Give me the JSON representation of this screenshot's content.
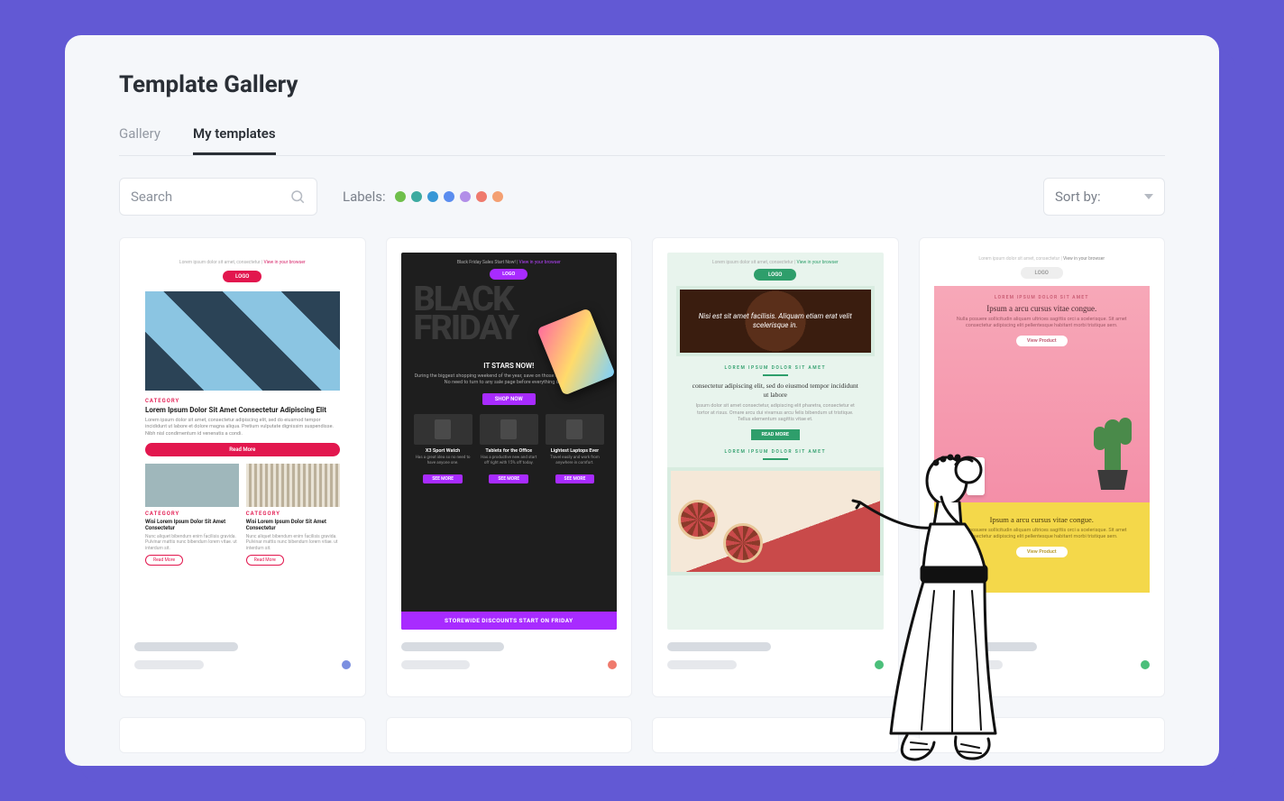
{
  "page_title": "Template Gallery",
  "tabs": [
    {
      "id": "gallery",
      "label": "Gallery",
      "active": false
    },
    {
      "id": "mytemplates",
      "label": "My templates",
      "active": true
    }
  ],
  "search": {
    "placeholder": "Search"
  },
  "labels": {
    "label": "Labels:",
    "colors": [
      "#6fbf4b",
      "#3daaa0",
      "#3897d6",
      "#5b8def",
      "#b28ee8",
      "#ef7a6d",
      "#f4a072"
    ]
  },
  "sort": {
    "label": "Sort by:"
  },
  "cards": [
    {
      "id": "t1",
      "dot_color": "#7b8fe0",
      "preheader": "Lorem ipsum dolor sit amet, consectetur |",
      "view_link": "View in your browser",
      "logo": "LOGO",
      "category": "CATEGORY",
      "headline": "Lorem Ipsum Dolor Sit Amet Consectetur Adipiscing Elit",
      "body": "Lorem ipsum dolor sit amet, consectetur adipiscing elit, sed do eiusmod tempor incididunt ut labore et dolore magna aliqua. Pretium vulputate dignissim suspendisse. Nibh nisl condimentum id venenatis a condi.",
      "read_more": "Read More",
      "cols": [
        {
          "category": "CATEGORY",
          "title": "Wisi Lorem Ipsum Dolor Sit Amet Consectetur",
          "body": "Nunc aliquet bibendum enim facilisis gravida. Pulvinar mattis nunc bibendum lorem vitae. ut interdum sit.",
          "cta": "Read More"
        },
        {
          "category": "CATEGORY",
          "title": "Wisi Lorem Ipsum Dolor Sit Amet Consectetur",
          "body": "Nunc aliquet bibendum enim facilisis gravida. Pulvinar mattis nunc bibendum lorem vitae. ut interdum sit.",
          "cta": "Read More"
        }
      ]
    },
    {
      "id": "t2",
      "dot_color": "#ef7a6d",
      "preheader": "Black Friday Sales Start Now! |",
      "view_link": "View in your browser",
      "logo": "LOGO",
      "bf1": "BLACK",
      "bf2": "FRIDAY",
      "it_stars": "IT STARS NOW!",
      "body": "During the biggest shopping weekend of the year, save on those items you really need. No need to turn to any sale page before everything is gone.",
      "shop_now": "SHOP NOW",
      "products": [
        {
          "name": "X3 Sport Watch",
          "desc": "Has a great idea so no need to have anyone one.",
          "cta": "SEE MORE"
        },
        {
          "name": "Tablets for the Office",
          "desc": "Has a productive new and start off right with 15% off today.",
          "cta": "SEE MORE"
        },
        {
          "name": "Lightest Laptops Ever",
          "desc": "Travel easily and work from anywhere in comfort.",
          "cta": "SEE MORE"
        }
      ],
      "banner": "STOREWIDE DISCOUNTS START ON FRIDAY"
    },
    {
      "id": "t3",
      "dot_color": "#4bbf7a",
      "preheader": "Lorem ipsum dolor sit amet, consectetur |",
      "view_link": "View in your browser",
      "logo": "LOGO",
      "hero_title": "Nisi est sit amet facilisis. Aliquam etiam erat velit scelerisque in.",
      "overline": "LOREM IPSUM DOLOR SIT AMET",
      "headline": "consectetur adipiscing elit, sed do eiusmod tempor incididunt ut labore",
      "body": "Ipsum dolor sit amet consectetur, adipiscing elit pharetra, consectetur et tortor at risus. Ornare arcu dui vivamus arcu felis bibendum ut tristique. Tellus elementum sagittis vitae et.",
      "read_more": "READ MORE",
      "overline2": "LOREM IPSUM DOLOR SIT AMET"
    },
    {
      "id": "t4",
      "dot_color": "#4bbf7a",
      "preheader": "Lorem ipsum dolor sit amet, consectetur |",
      "view_link": "View in your browser",
      "logo": "LOGO",
      "overline": "LOREM IPSUM DOLOR SIT AMET",
      "headline": "Ipsum a arcu cursus vitae congue.",
      "body": "Nulla posuere sollicitudin aliquam ultrices sagittis orci a scelerisque. Sit amet consectetur adipiscing elit pellentesque habitant morbi tristique sem.",
      "view_product": "View Product",
      "headline2": "Ipsum a arcu cursus vitae congue.",
      "body2": "Nulla posuere sollicitudin aliquam ultrices sagittis orci a scelerisque. Sit amet consectetur adipiscing elit pellentesque habitant morbi tristique sem.",
      "view_product2": "View Product"
    }
  ]
}
